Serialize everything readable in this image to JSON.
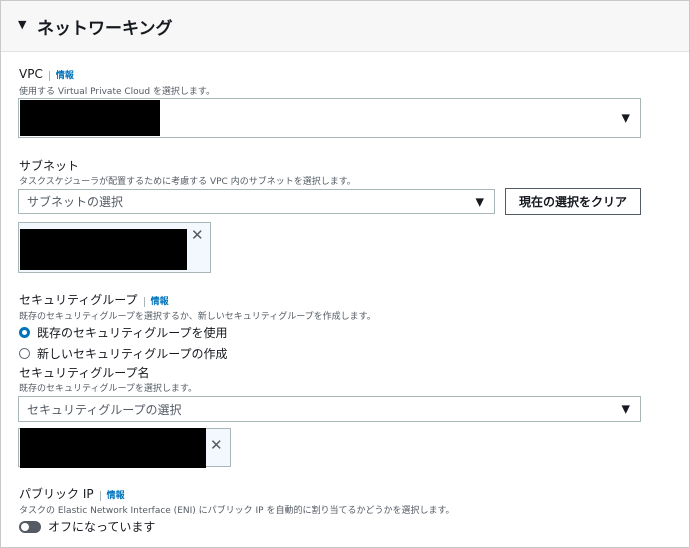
{
  "section": {
    "title": "ネットワーキング"
  },
  "vpc": {
    "label": "VPC",
    "info": "情報",
    "description": "使用する Virtual Private Cloud を選択します。"
  },
  "subnet": {
    "label": "サブネット",
    "description": "タスクスケジューラが配置するために考慮する VPC 内のサブネットを選択します。",
    "placeholder": "サブネットの選択",
    "clear_button": "現在の選択をクリア"
  },
  "security_group": {
    "label": "セキュリティグループ",
    "info": "情報",
    "description": "既存のセキュリティグループを選択するか、新しいセキュリティグループを作成します。",
    "options": [
      {
        "label": "既存のセキュリティグループを使用",
        "selected": true
      },
      {
        "label": "新しいセキュリティグループの作成",
        "selected": false
      }
    ],
    "name_label": "セキュリティグループ名",
    "name_description": "既存のセキュリティグループを選択します。",
    "placeholder": "セキュリティグループの選択"
  },
  "public_ip": {
    "label": "パブリック IP",
    "info": "情報",
    "description": "タスクの Elastic Network Interface (ENI) にパブリック IP を自動的に割り当てるかどうかを選択します。",
    "toggle_label": "オフになっています",
    "enabled": false
  }
}
